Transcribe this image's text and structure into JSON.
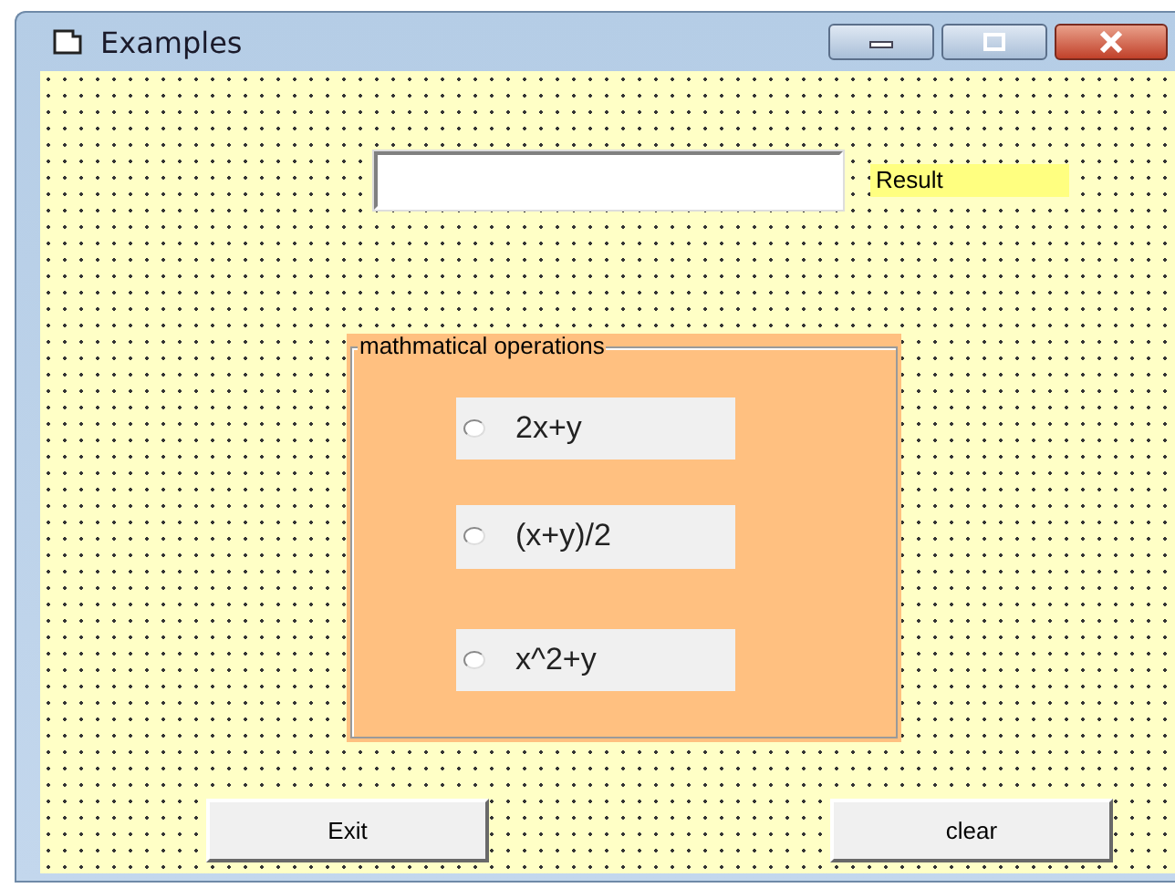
{
  "window": {
    "title": "Examples"
  },
  "result_label": "Result",
  "group": {
    "title": "mathmatical operations",
    "options": [
      {
        "label": "2x+y",
        "selected": false
      },
      {
        "label": "(x+y)/2",
        "selected": false
      },
      {
        "label": "x^2+y",
        "selected": false
      }
    ]
  },
  "buttons": [
    {
      "label": "Exit"
    },
    {
      "label": "clear"
    }
  ]
}
